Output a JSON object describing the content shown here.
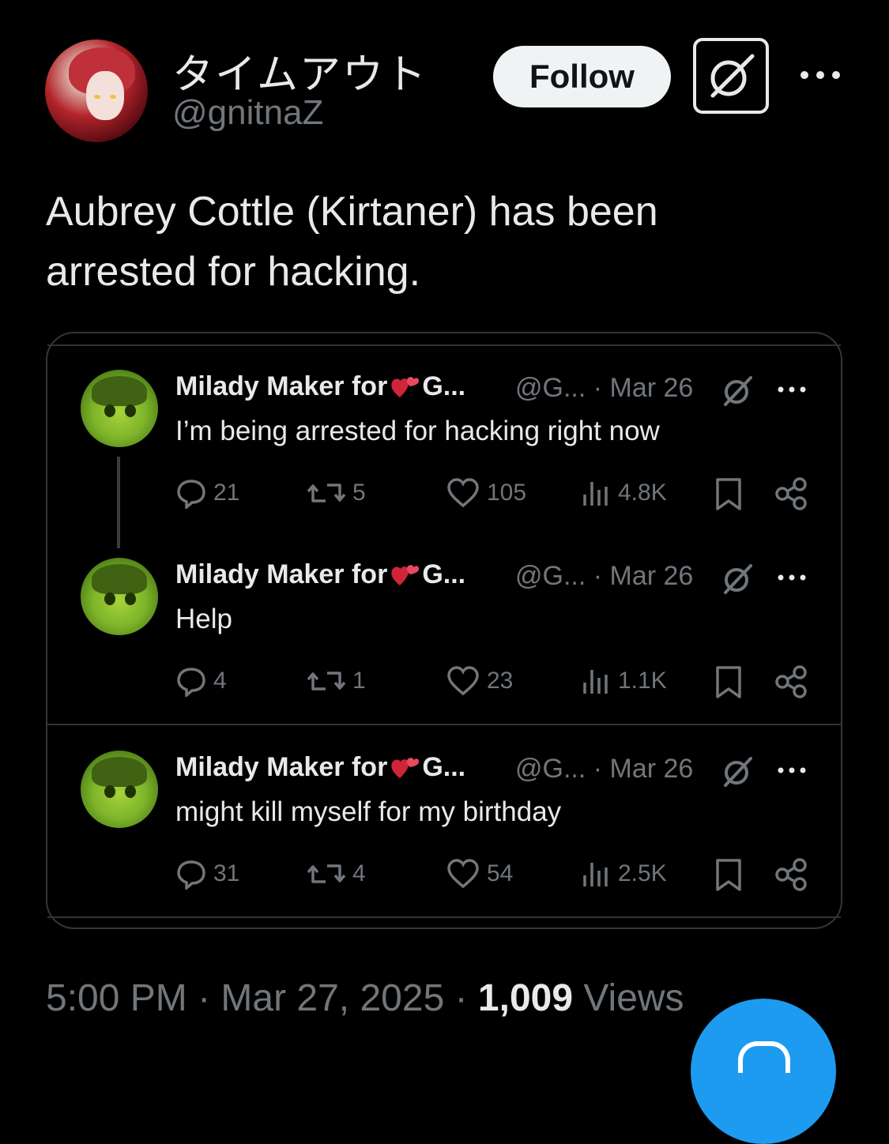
{
  "author": {
    "display_name": "タイムアウト",
    "handle": "@gnitnaZ",
    "follow_label": "Follow"
  },
  "tweet": {
    "text_line1": "Aubrey Cottle (Kirtaner) has been",
    "text_line2": "arrested for hacking."
  },
  "quoted": [
    {
      "name_pre": "Milady Maker for",
      "name_post": "G...",
      "meta": "@G... · Mar 26",
      "text": "I’m being arrested for hacking right now",
      "replies": "21",
      "reposts": "5",
      "likes": "105",
      "views": "4.8K"
    },
    {
      "name_pre": "Milady Maker for",
      "name_post": "G...",
      "meta": "@G... · Mar 26",
      "text": "Help",
      "replies": "4",
      "reposts": "1",
      "likes": "23",
      "views": "1.1K"
    },
    {
      "name_pre": "Milady Maker for",
      "name_post": "G...",
      "meta": "@G... · Mar 26",
      "text": "might kill myself for my birthday",
      "replies": "31",
      "reposts": "4",
      "likes": "54",
      "views": "2.5K"
    }
  ],
  "footer": {
    "time": "5:00 PM · Mar 27, 2025 · ",
    "views_count": "1,009",
    "views_label": " Views"
  },
  "colors": {
    "background": "#000000",
    "text": "#e7e9ea",
    "muted": "#71767b",
    "accent": "#1d9bf0"
  },
  "icons": [
    "grok-icon",
    "more-icon",
    "reply-icon",
    "repost-icon",
    "like-icon",
    "views-icon",
    "bookmark-icon",
    "share-icon",
    "compose-icon"
  ]
}
